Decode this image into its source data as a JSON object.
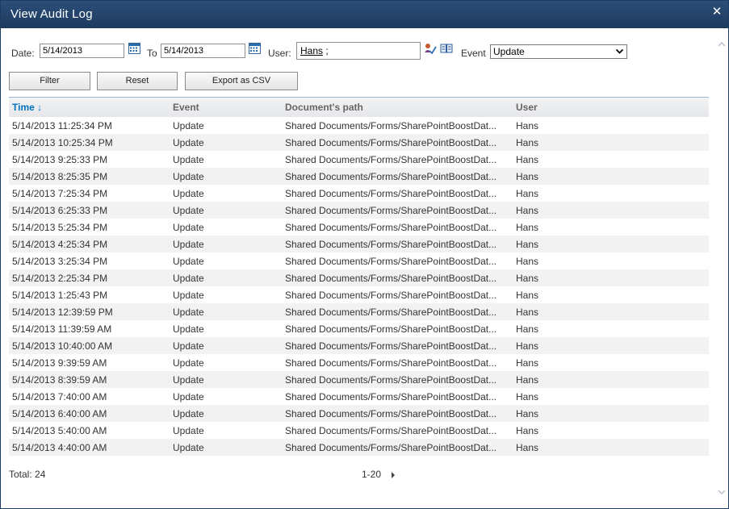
{
  "dialog": {
    "title": "View Audit Log",
    "close_glyph": "✕"
  },
  "filters": {
    "date_label": "Date:",
    "date_from": "5/14/2013",
    "to_label": "To",
    "date_to": "5/14/2013",
    "user_label": "User:",
    "user_value": "Hans",
    "user_suffix": " ;",
    "event_label": "Event",
    "event_selected": "Update"
  },
  "buttons": {
    "filter": "Filter",
    "reset": "Reset",
    "export": "Export as CSV"
  },
  "grid": {
    "columns": [
      "Time ↓",
      "Event",
      "Document's path",
      "User"
    ],
    "rows": [
      [
        "5/14/2013 11:25:34 PM",
        "Update",
        "Shared Documents/Forms/SharePointBoostDat...",
        "Hans"
      ],
      [
        "5/14/2013 10:25:34 PM",
        "Update",
        "Shared Documents/Forms/SharePointBoostDat...",
        "Hans"
      ],
      [
        "5/14/2013 9:25:33 PM",
        "Update",
        "Shared Documents/Forms/SharePointBoostDat...",
        "Hans"
      ],
      [
        "5/14/2013 8:25:35 PM",
        "Update",
        "Shared Documents/Forms/SharePointBoostDat...",
        "Hans"
      ],
      [
        "5/14/2013 7:25:34 PM",
        "Update",
        "Shared Documents/Forms/SharePointBoostDat...",
        "Hans"
      ],
      [
        "5/14/2013 6:25:33 PM",
        "Update",
        "Shared Documents/Forms/SharePointBoostDat...",
        "Hans"
      ],
      [
        "5/14/2013 5:25:34 PM",
        "Update",
        "Shared Documents/Forms/SharePointBoostDat...",
        "Hans"
      ],
      [
        "5/14/2013 4:25:34 PM",
        "Update",
        "Shared Documents/Forms/SharePointBoostDat...",
        "Hans"
      ],
      [
        "5/14/2013 3:25:34 PM",
        "Update",
        "Shared Documents/Forms/SharePointBoostDat...",
        "Hans"
      ],
      [
        "5/14/2013 2:25:34 PM",
        "Update",
        "Shared Documents/Forms/SharePointBoostDat...",
        "Hans"
      ],
      [
        "5/14/2013 1:25:43 PM",
        "Update",
        "Shared Documents/Forms/SharePointBoostDat...",
        "Hans"
      ],
      [
        "5/14/2013 12:39:59 PM",
        "Update",
        "Shared Documents/Forms/SharePointBoostDat...",
        "Hans"
      ],
      [
        "5/14/2013 11:39:59 AM",
        "Update",
        "Shared Documents/Forms/SharePointBoostDat...",
        "Hans"
      ],
      [
        "5/14/2013 10:40:00 AM",
        "Update",
        "Shared Documents/Forms/SharePointBoostDat...",
        "Hans"
      ],
      [
        "5/14/2013 9:39:59 AM",
        "Update",
        "Shared Documents/Forms/SharePointBoostDat...",
        "Hans"
      ],
      [
        "5/14/2013 8:39:59 AM",
        "Update",
        "Shared Documents/Forms/SharePointBoostDat...",
        "Hans"
      ],
      [
        "5/14/2013 7:40:00 AM",
        "Update",
        "Shared Documents/Forms/SharePointBoostDat...",
        "Hans"
      ],
      [
        "5/14/2013 6:40:00 AM",
        "Update",
        "Shared Documents/Forms/SharePointBoostDat...",
        "Hans"
      ],
      [
        "5/14/2013 5:40:00 AM",
        "Update",
        "Shared Documents/Forms/SharePointBoostDat...",
        "Hans"
      ],
      [
        "5/14/2013 4:40:00 AM",
        "Update",
        "Shared Documents/Forms/SharePointBoostDat...",
        "Hans"
      ]
    ]
  },
  "footer": {
    "total": "Total: 24",
    "range": "1-20"
  },
  "icons": {
    "calendar": "calendar-icon",
    "check_names": "check-names-icon",
    "browse": "address-book-icon",
    "pager_next": "next-page-arrow-icon"
  },
  "colors": {
    "titlebar": "#1d3a5f",
    "sorted_header": "#0072bc",
    "alt_row": "#f2f2f2"
  }
}
